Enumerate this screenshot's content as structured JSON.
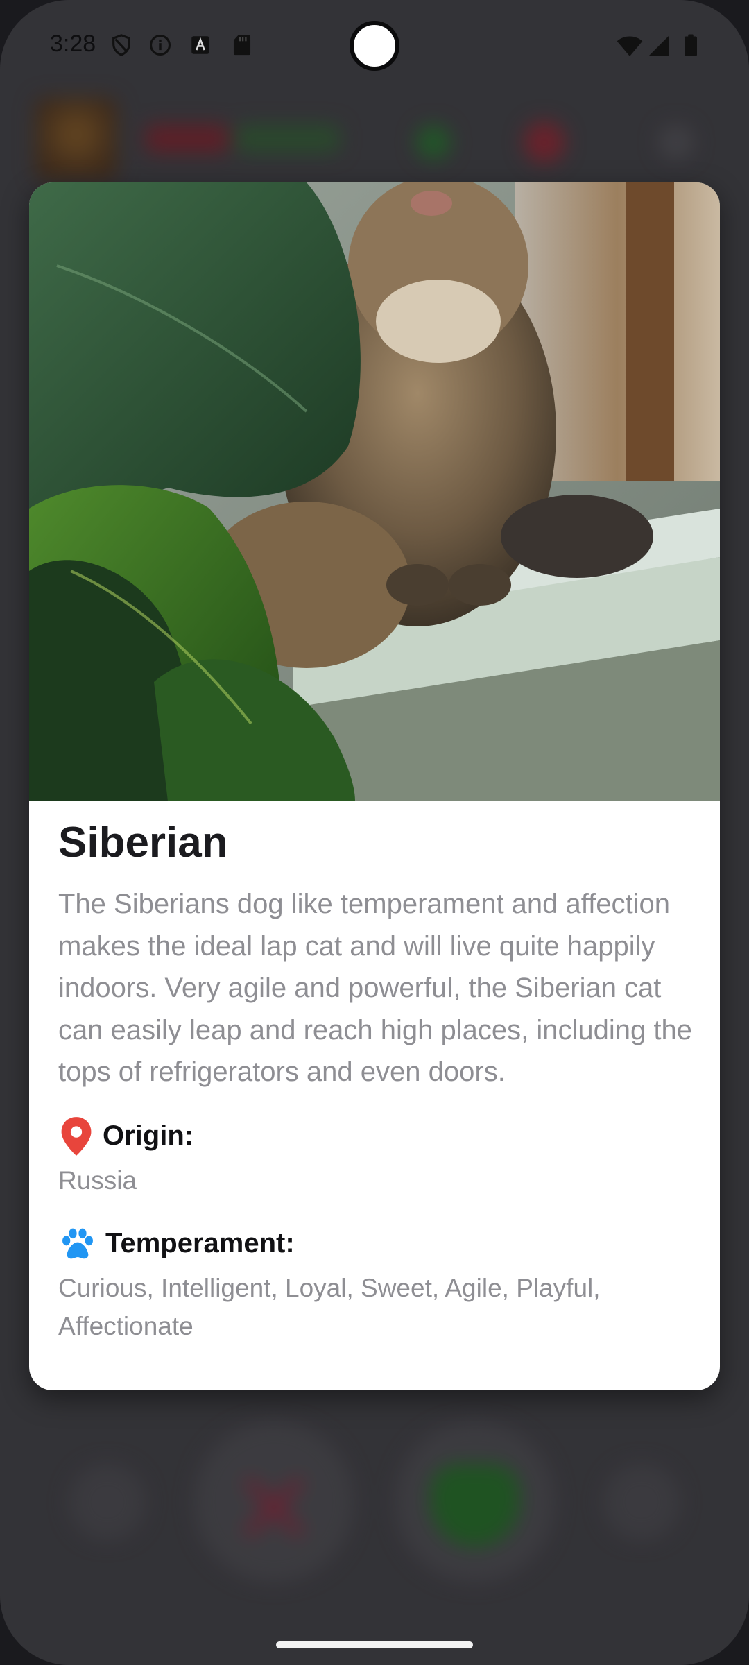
{
  "status_bar": {
    "time": "3:28"
  },
  "card": {
    "breed_name": "Siberian",
    "description": "The Siberians dog like temperament and affection makes the ideal lap cat and will live quite happily indoors. Very agile and powerful, the Siberian cat can easily leap and reach high places, including the tops of refrigerators and even doors.",
    "origin": {
      "icon": "map-pin-icon",
      "label": "Origin:",
      "value": "Russia"
    },
    "temperament": {
      "icon": "paw-icon",
      "label": "Temperament:",
      "value": "Curious, Intelligent, Loyal, Sweet, Agile, Playful, Affectionate"
    }
  },
  "colors": {
    "origin_icon": "#e8453c",
    "temperament_icon": "#2196f3",
    "title_text": "#1b1b1f",
    "secondary_text": "#8e8e93"
  }
}
